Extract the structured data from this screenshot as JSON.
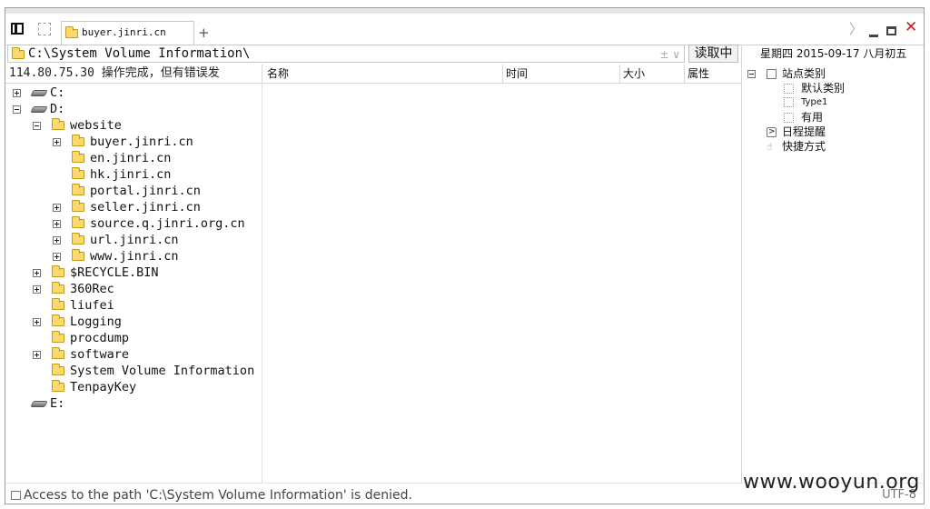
{
  "tab": {
    "title": "buyer.jinri.cn",
    "add_symbol": "+"
  },
  "window_controls": {
    "chevron": "〉",
    "close": "✕"
  },
  "path_bar": {
    "path": "C:\\System Volume Information\\",
    "controls": "±  ∨",
    "read_button": "读取中"
  },
  "date": "星期四 2015-09-17 八月初五",
  "status_left": "114.80.75.30   操作完成，但有错误发",
  "columns": [
    "名称",
    "时间",
    "大小",
    "属性"
  ],
  "tree": [
    {
      "label": "C:",
      "kind": "drive",
      "toggle": "plus"
    },
    {
      "label": "D:",
      "kind": "drive",
      "toggle": "minus"
    },
    {
      "label": "website",
      "kind": "folder",
      "toggle": "minus"
    },
    {
      "label": "buyer.jinri.cn",
      "kind": "folder",
      "toggle": "plus"
    },
    {
      "label": "en.jinri.cn",
      "kind": "folder",
      "toggle": "none"
    },
    {
      "label": "hk.jinri.cn",
      "kind": "folder",
      "toggle": "none"
    },
    {
      "label": "portal.jinri.cn",
      "kind": "folder",
      "toggle": "none"
    },
    {
      "label": "seller.jinri.cn",
      "kind": "folder",
      "toggle": "plus"
    },
    {
      "label": "source.q.jinri.org.cn",
      "kind": "folder",
      "toggle": "plus"
    },
    {
      "label": "url.jinri.cn",
      "kind": "folder",
      "toggle": "plus"
    },
    {
      "label": "www.jinri.cn",
      "kind": "folder",
      "toggle": "plus"
    },
    {
      "label": "$RECYCLE.BIN",
      "kind": "folder",
      "toggle": "plus"
    },
    {
      "label": "360Rec",
      "kind": "folder",
      "toggle": "plus"
    },
    {
      "label": "liufei",
      "kind": "folder",
      "toggle": "none"
    },
    {
      "label": "Logging",
      "kind": "folder",
      "toggle": "plus"
    },
    {
      "label": "procdump",
      "kind": "folder",
      "toggle": "none"
    },
    {
      "label": "software",
      "kind": "folder",
      "toggle": "plus"
    },
    {
      "label": "System Volume Information",
      "kind": "folder",
      "toggle": "none"
    },
    {
      "label": "TenpayKey",
      "kind": "folder",
      "toggle": "none"
    },
    {
      "label": "E:",
      "kind": "drive",
      "toggle": "none"
    }
  ],
  "side_panel": {
    "site_categories": "站点类别",
    "categories": [
      "默认类别",
      "Type1",
      "有用"
    ],
    "schedule": "日程提醒",
    "shortcuts": "快捷方式"
  },
  "status_message": "Access to the path 'C:\\System Volume Information' is denied.",
  "encoding": "UTF-8",
  "watermark": "www.wooyun.org"
}
